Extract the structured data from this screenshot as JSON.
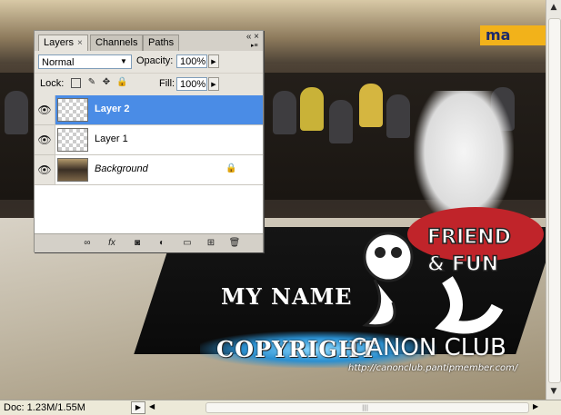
{
  "photo": {
    "store_sign": "ma",
    "watermark_line1": "MY NAME",
    "watermark_line2": "COPYRIGHT",
    "logo_friend": "FRIEND",
    "logo_fun": "& FUN",
    "logo_club": "CANON CLUB",
    "logo_url": "http://canonclub.pantipmember.com/"
  },
  "panel": {
    "tabs": [
      {
        "label": "Layers",
        "active": true,
        "close": "×"
      },
      {
        "label": "Channels",
        "active": false
      },
      {
        "label": "Paths",
        "active": false
      }
    ],
    "window_buttons": "« ×",
    "blend_mode": "Normal",
    "opacity_label": "Opacity:",
    "opacity_value": "100%",
    "lock_label": "Lock:",
    "fill_label": "Fill:",
    "fill_value": "100%",
    "layers": [
      {
        "name": "Layer 2",
        "selected": true,
        "visible": true,
        "thumb": "transparent"
      },
      {
        "name": "Layer 1",
        "selected": false,
        "visible": true,
        "thumb": "transparent"
      },
      {
        "name": "Background",
        "selected": false,
        "visible": true,
        "thumb": "photo",
        "locked": true,
        "italic": true
      }
    ],
    "footer_icons": [
      "link-icon",
      "fx-icon",
      "mask-icon",
      "adjustment-icon",
      "folder-icon",
      "new-layer-icon",
      "trash-icon"
    ],
    "fx_label": "fx"
  },
  "statusbar": {
    "doc_info": "Doc: 1.23M/1.55M"
  },
  "colors": {
    "selection": "#4a8ce6",
    "panel_bg": "#d4d0c8",
    "stool": "#c0242a",
    "sign": "#f2b21a"
  }
}
